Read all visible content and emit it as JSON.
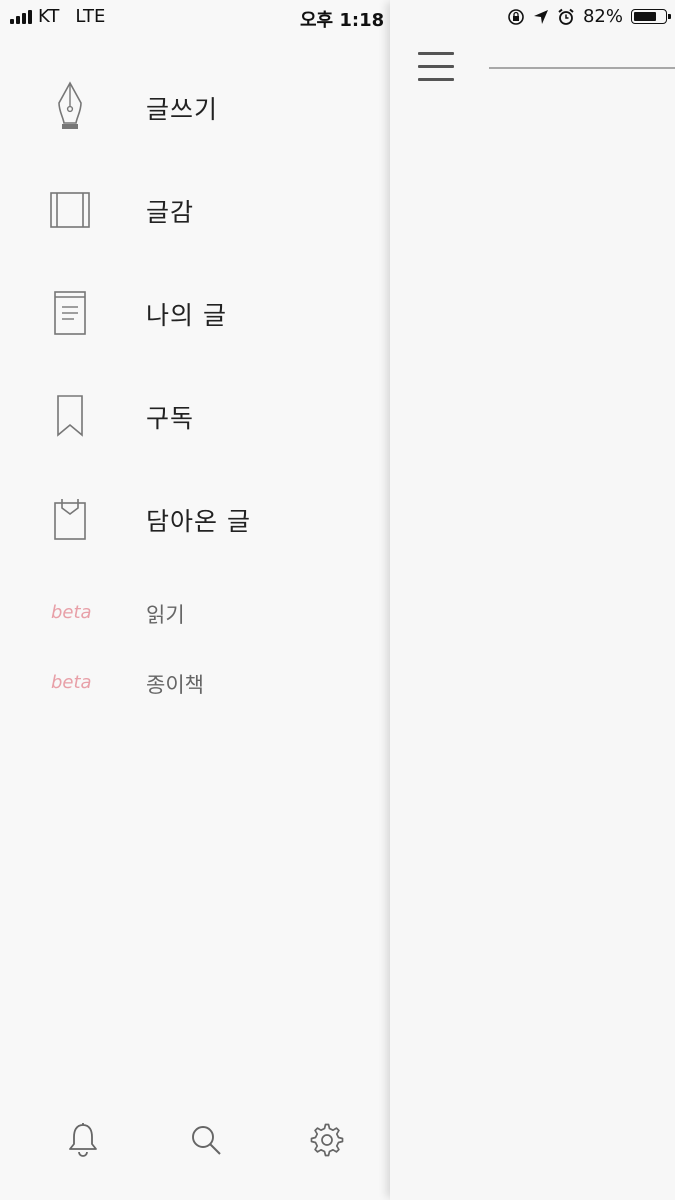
{
  "status": {
    "carrier": "KT",
    "network": "LTE",
    "time": "오후 1:18",
    "battery": "82%",
    "battery_level": 0.82
  },
  "menu": {
    "items": [
      {
        "label": "글쓰기",
        "icon": "fountain-pen-icon"
      },
      {
        "label": "글감",
        "icon": "film-frame-icon"
      },
      {
        "label": "나의 글",
        "icon": "document-icon"
      },
      {
        "label": "구독",
        "icon": "bookmark-icon"
      },
      {
        "label": "담아온 글",
        "icon": "tray-icon"
      }
    ],
    "beta_items": [
      {
        "tag": "beta",
        "label": "읽기"
      },
      {
        "tag": "beta",
        "label": "종이책"
      }
    ]
  },
  "bottom": {
    "icons": [
      "bell-icon",
      "search-icon",
      "gear-icon"
    ]
  },
  "colors": {
    "beta_tag": "#e8a0a8",
    "icon_stroke": "#777777",
    "background": "#f7f7f7"
  }
}
